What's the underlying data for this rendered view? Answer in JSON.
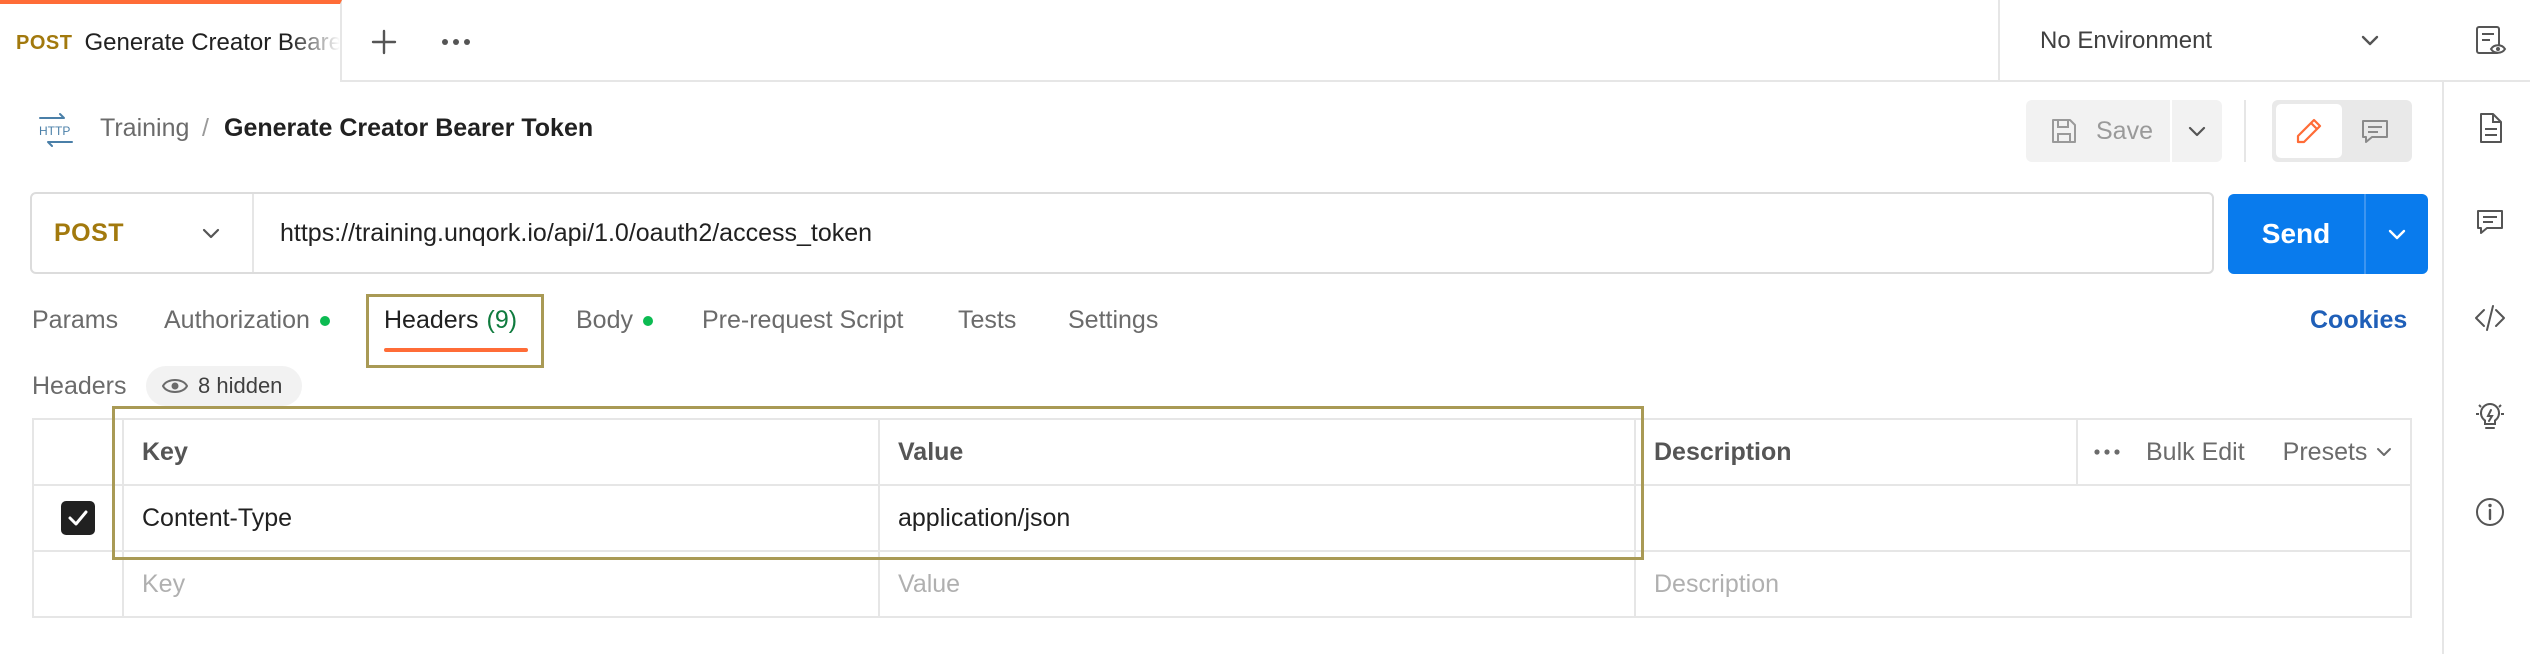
{
  "tabbar": {
    "active_tab": {
      "method": "POST",
      "title": "Generate Creator Bearer Token"
    },
    "environment": "No Environment"
  },
  "breadcrumb": {
    "icon_label": "HTTP",
    "parent": "Training",
    "separator": "/",
    "current": "Generate Creator Bearer Token"
  },
  "toolbar": {
    "save_label": "Save"
  },
  "request": {
    "method": "POST",
    "url": "https://training.unqork.io/api/1.0/oauth2/access_token",
    "send_label": "Send"
  },
  "request_tabs": [
    {
      "label": "Params"
    },
    {
      "label": "Authorization"
    },
    {
      "label": "Headers",
      "count": "(9)"
    },
    {
      "label": "Body"
    },
    {
      "label": "Pre-request Script"
    },
    {
      "label": "Tests"
    },
    {
      "label": "Settings"
    }
  ],
  "cookies_label": "Cookies",
  "headers_section": {
    "label": "Headers",
    "hidden_chip": "8 hidden",
    "columns": {
      "key": "Key",
      "value": "Value",
      "description": "Description"
    },
    "bulk_edit": "Bulk Edit",
    "presets": "Presets",
    "rows": [
      {
        "key": "Content-Type",
        "value": "application/json",
        "description": "",
        "checked": true
      }
    ],
    "placeholder": {
      "key": "Key",
      "value": "Value",
      "description": "Description"
    }
  },
  "colors": {
    "accent": "#ff6c37",
    "method": "#a2790d",
    "send": "#097bed",
    "status_dot": "#0cbb52",
    "highlight": "#a99a55",
    "link": "#1f5fb8"
  },
  "icons": {
    "tab_add": "plus-icon",
    "tab_more": "ellipsis-icon",
    "environment_dropdown": "chevron-down-icon",
    "environment_quick_look": "eye-icon",
    "save": "floppy-icon",
    "edit_mode": "pencil-icon",
    "comment_mode": "comment-icon",
    "sidebar": [
      "documentation-icon",
      "comment-icon",
      "code-icon",
      "lightbulb-icon",
      "info-icon"
    ]
  }
}
